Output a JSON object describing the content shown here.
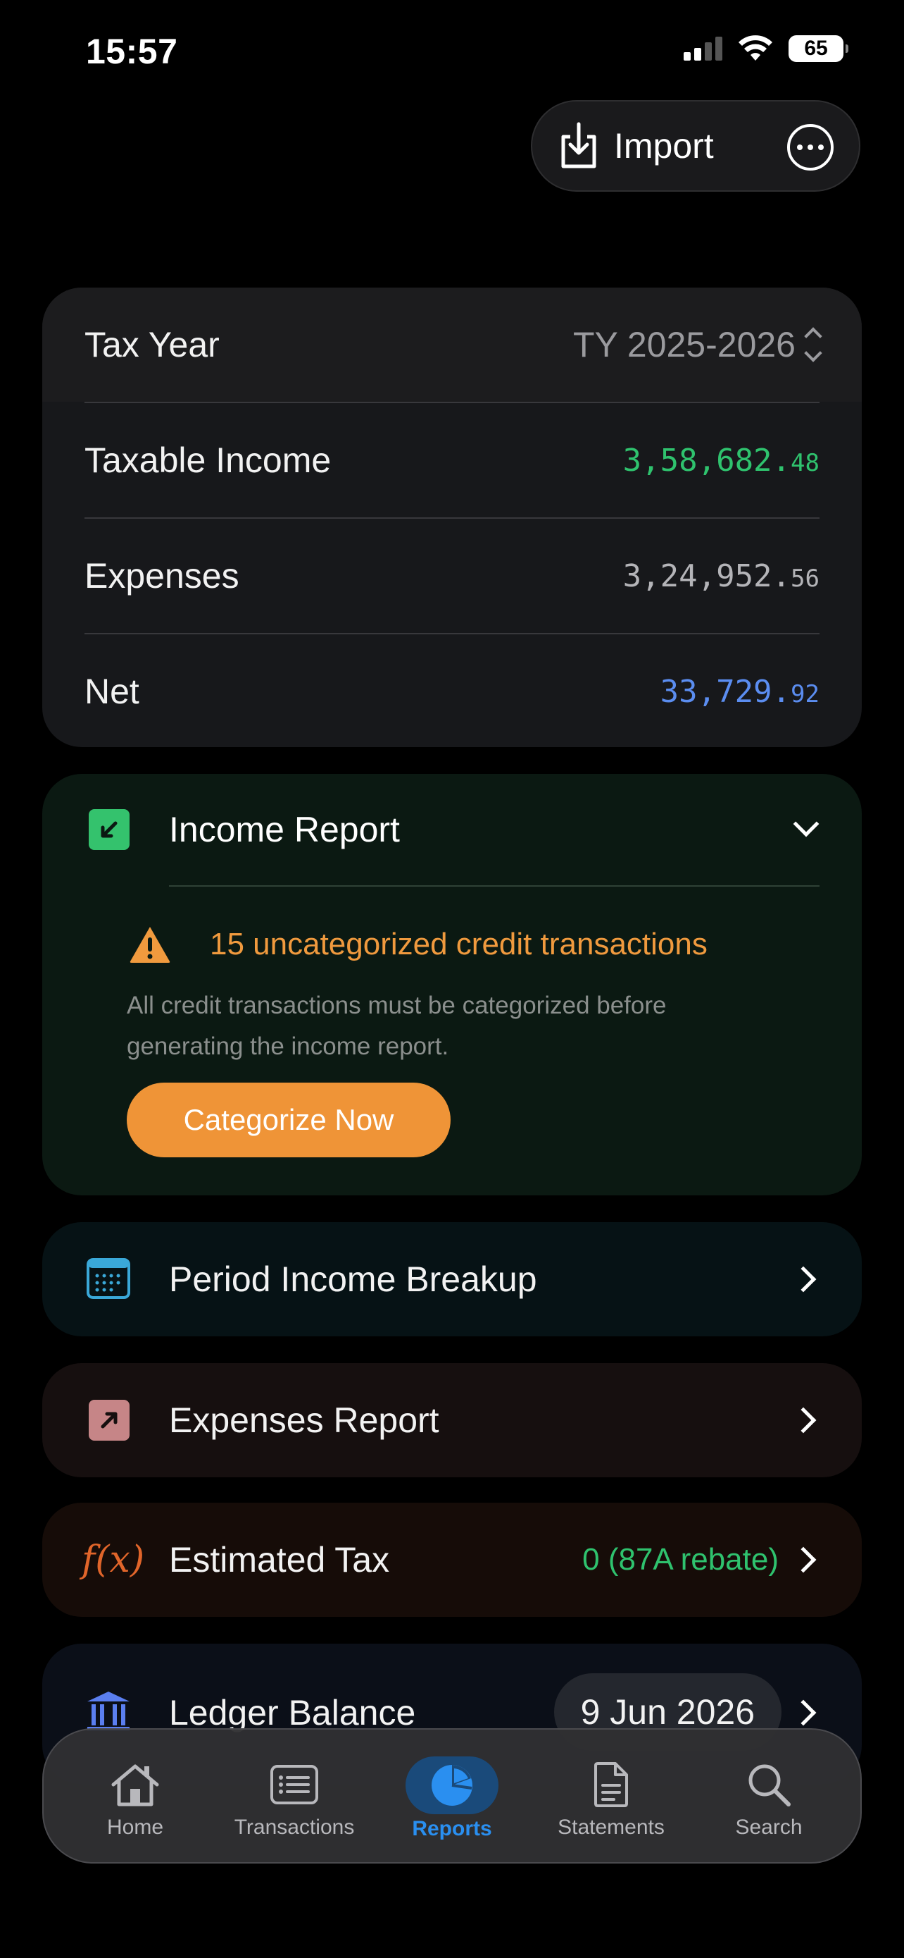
{
  "status_bar": {
    "time": "15:57",
    "battery": "65"
  },
  "top_bar": {
    "import_label": "Import"
  },
  "summary": {
    "tax_year_label": "Tax Year",
    "tax_year_value": "TY 2025-2026",
    "taxable_income_label": "Taxable Income",
    "taxable_income_main": "3,58,682.",
    "taxable_income_decimal": "48",
    "expenses_label": "Expenses",
    "expenses_main": "3,24,952.",
    "expenses_decimal": "56",
    "net_label": "Net",
    "net_main": "33,729.",
    "net_decimal": "92"
  },
  "income_report": {
    "title": "Income Report",
    "warning": "15 uncategorized credit transactions",
    "description": "All credit transactions must be categorized before generating the income report.",
    "action_label": "Categorize Now"
  },
  "period_income": {
    "title": "Period Income Breakup"
  },
  "expenses_report": {
    "title": "Expenses Report"
  },
  "estimated_tax": {
    "icon_text": "f(x)",
    "title": "Estimated Tax",
    "value": "0 (87A rebate)"
  },
  "ledger": {
    "title": "Ledger Balance",
    "date": "9 Jun 2026"
  },
  "tabs": [
    {
      "label": "Home",
      "icon": "house-icon"
    },
    {
      "label": "Transactions",
      "icon": "list-icon"
    },
    {
      "label": "Reports",
      "icon": "pie-chart-icon"
    },
    {
      "label": "Statements",
      "icon": "document-icon"
    },
    {
      "label": "Search",
      "icon": "magnifier-icon"
    }
  ],
  "colors": {
    "accent_blue": "#2a8ff0",
    "income_green": "#2fc26e",
    "net_blue": "#5b8df0",
    "warning_orange": "#f09a3e",
    "button_orange": "#ef9437"
  }
}
